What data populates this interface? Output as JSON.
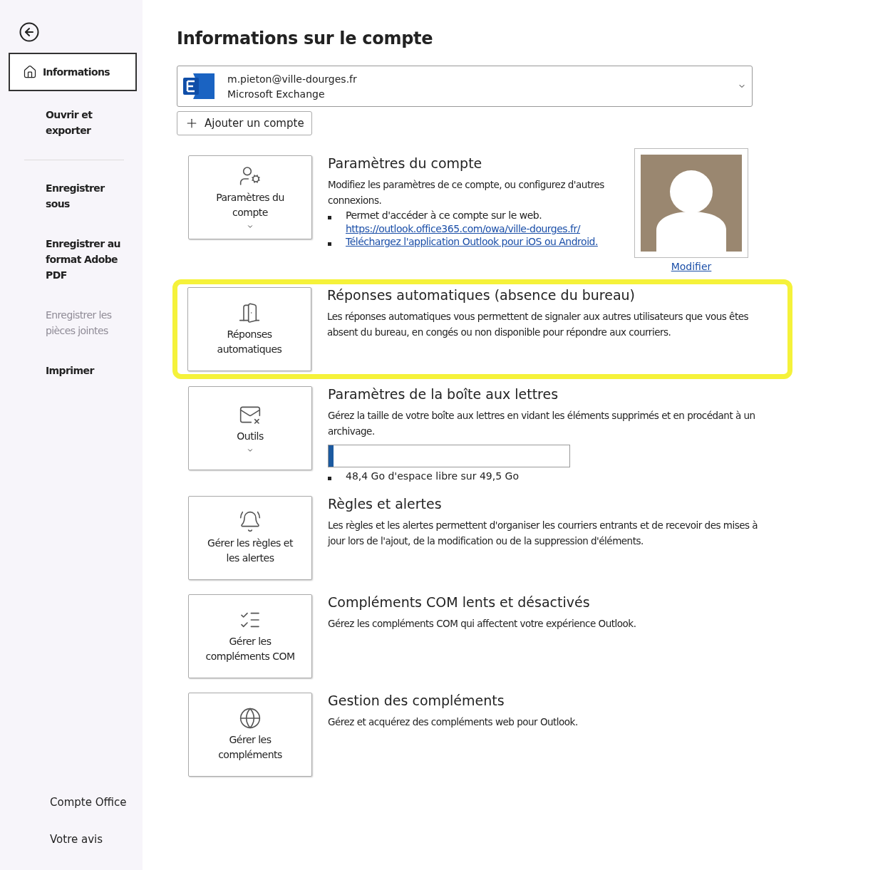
{
  "sidebar": {
    "items": [
      {
        "label": "Informations",
        "selected": true,
        "disabled": false
      },
      {
        "label": "Ouvrir et exporter",
        "selected": false,
        "disabled": false
      },
      {
        "label": "Enregistrer sous",
        "selected": false,
        "disabled": false
      },
      {
        "label": "Enregistrer au format Adobe PDF",
        "selected": false,
        "disabled": false
      },
      {
        "label": "Enregistrer les pièces jointes",
        "selected": false,
        "disabled": true
      },
      {
        "label": "Imprimer",
        "selected": false,
        "disabled": false
      }
    ],
    "footer_items": [
      "Compte Office",
      "Votre avis"
    ]
  },
  "title": "Informations sur le compte",
  "account": {
    "email": "m.pieton@ville-dourges.fr",
    "type": "Microsoft Exchange"
  },
  "add_account_button": "Ajouter un compte",
  "sections": [
    {
      "kind": "account",
      "highlighted": false,
      "tile": {
        "label": "Paramètres du compte",
        "caret": true
      },
      "heading": "Paramètres du compte",
      "description": "Modifiez les paramètres de ce compte, ou configurez d'autres connexions.",
      "bullets": [
        {
          "text": "Permet d'accéder à ce compte sur le web.",
          "link": "https://outlook.office365.com/owa/ville-dourges.fr/"
        },
        {
          "link": "Téléchargez l'application Outlook pour iOS ou Android."
        }
      ],
      "photo_link": "Modifier"
    },
    {
      "kind": "plain",
      "highlighted": true,
      "tile": {
        "label": "Réponses automatiques",
        "caret": false
      },
      "heading": "Réponses automatiques (absence du bureau)",
      "description": "Les réponses automatiques vous permettent de signaler aux autres utilisateurs que vous êtes absent du bureau, en congés ou non disponible pour répondre aux courriers."
    },
    {
      "kind": "mailbox",
      "highlighted": false,
      "tile": {
        "label": "Outils",
        "caret": true
      },
      "heading": "Paramètres de la boîte aux lettres",
      "description": "Gérez la taille de votre boîte aux lettres en vidant les éléments supprimés et en procédant à un archivage.",
      "level": 0.02,
      "usage": "48,4 Go d'espace libre sur 49,5 Go"
    },
    {
      "kind": "plain",
      "highlighted": false,
      "tile": {
        "label": "Gérer les règles et les alertes",
        "caret": false
      },
      "heading": "Règles et alertes",
      "description": "Les règles et les alertes permettent d'organiser les courriers entrants et de recevoir des mises à jour lors de l'ajout, de la modification ou de la suppression d'éléments."
    },
    {
      "kind": "plain",
      "highlighted": false,
      "tile": {
        "label": "Gérer les compléments COM",
        "caret": false
      },
      "heading": "Compléments COM lents et désactivés",
      "description": "Gérez les compléments COM qui affectent votre expérience Outlook."
    },
    {
      "kind": "plain",
      "highlighted": false,
      "tile": {
        "label": "Gérer les compléments",
        "caret": false
      },
      "heading": "Gestion des compléments",
      "description": "Gérez et acquérez des compléments web pour Outlook."
    }
  ]
}
